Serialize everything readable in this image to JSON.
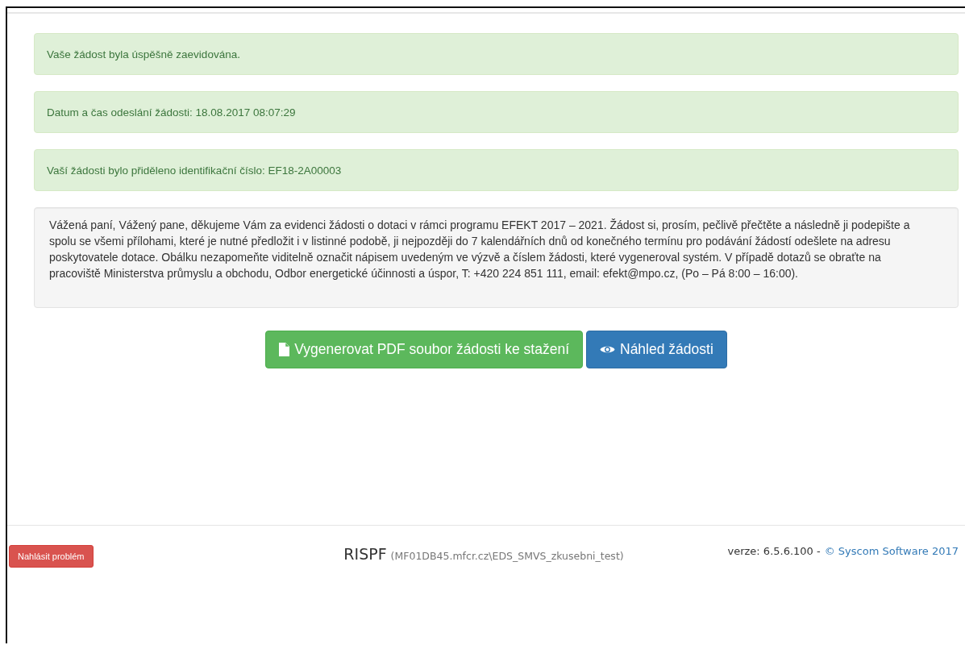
{
  "alerts": [
    "Vaše žádost byla úspěšně zaevidována.",
    "Datum a čas odeslání žádosti: 18.08.2017 08:07:29",
    "Vaší žádosti bylo přiděleno identifikační číslo: EF18-2A00003"
  ],
  "notice": "Vážená paní, Vážený pane, děkujeme Vám za evidenci žádosti o dotaci v rámci programu EFEKT 2017 – 2021. Žádost si, prosím, pečlivě přečtěte a následně ji podepište a spolu se všemi přílohami, které je nutné předložit i v listinné podobě, ji nejpozději do 7 kalendářních dnů od konečného termínu pro podávání žádostí odešlete na adresu poskytovatele dotace. Obálku nezapomeňte viditelně označit nápisem uvedeným ve výzvě a číslem žádosti, které vygeneroval systém. V případě dotazů se obraťte na pracoviště Ministerstva průmyslu a obchodu, Odbor energetické účinnosti a úspor, T: +420 224 851 111, email: efekt@mpo.cz, (Po – Pá 8:00 – 16:00).",
  "buttons": [
    {
      "kind": "success",
      "label": "Vygenerovat PDF soubor žádosti ke stažení"
    },
    {
      "kind": "primary",
      "label": "Náhled žádosti"
    }
  ],
  "footer": {
    "report_button": "Nahlásit problém",
    "app_name": "RISPF",
    "server": "(MF01DB45.mfcr.cz\\EDS_SMVS_zkusebni_test)",
    "version": "verze: 6.5.6.100 -",
    "copyright_link": "© Syscom Software 2017"
  }
}
